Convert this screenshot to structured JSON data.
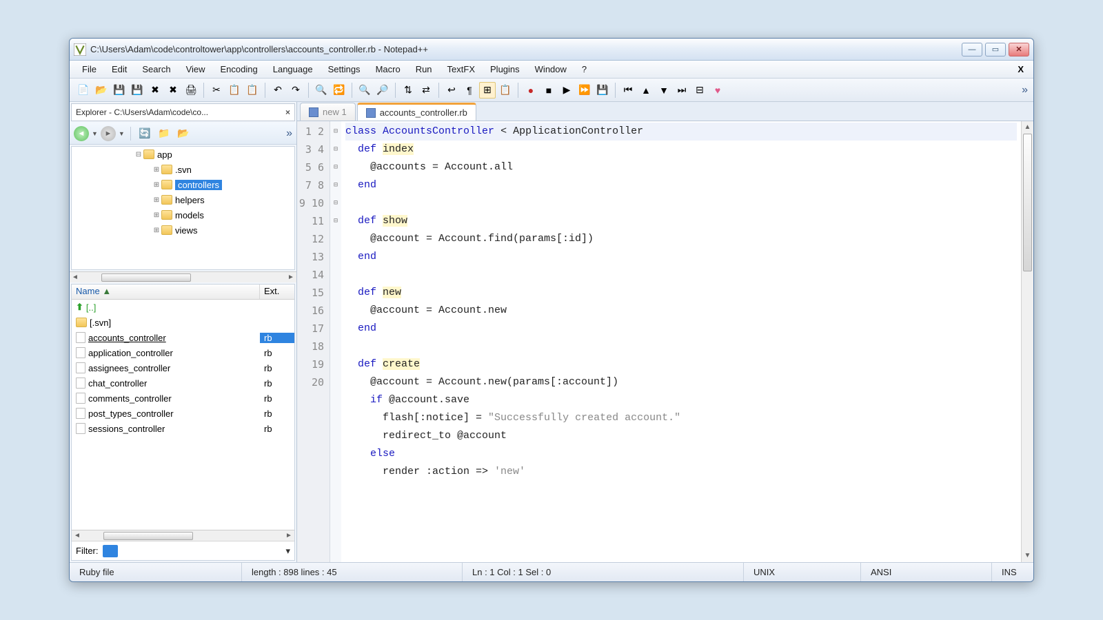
{
  "titlebar": {
    "title": "C:\\Users\\Adam\\code\\controltower\\app\\controllers\\accounts_controller.rb - Notepad++"
  },
  "menu": {
    "items": [
      "File",
      "Edit",
      "Search",
      "View",
      "Encoding",
      "Language",
      "Settings",
      "Macro",
      "Run",
      "TextFX",
      "Plugins",
      "Window",
      "?"
    ],
    "x": "X"
  },
  "toolbar": {
    "icons": [
      "new",
      "open",
      "save",
      "save-all",
      "close",
      "close-all",
      "print",
      "sep",
      "cut",
      "copy",
      "paste",
      "sep",
      "undo",
      "redo",
      "sep",
      "find",
      "replace",
      "sep",
      "zoom-in",
      "zoom-out",
      "sep",
      "sync-v",
      "sync-h",
      "sep",
      "wrap",
      "show-all",
      "indent-guide",
      "udl",
      "sep",
      "record",
      "stop",
      "play",
      "play-multi",
      "save-macro",
      "sep",
      "to-start",
      "up",
      "down",
      "to-end",
      "fold-all",
      "heart"
    ],
    "more": "»"
  },
  "explorer": {
    "title": "Explorer - C:\\Users\\Adam\\code\\co...",
    "tree": [
      {
        "indent": 0,
        "exp": "⊟",
        "label": "app"
      },
      {
        "indent": 1,
        "exp": "⊞",
        "label": ".svn"
      },
      {
        "indent": 1,
        "exp": "⊞",
        "label": "controllers",
        "selected": true
      },
      {
        "indent": 1,
        "exp": "⊞",
        "label": "helpers"
      },
      {
        "indent": 1,
        "exp": "⊞",
        "label": "models"
      },
      {
        "indent": 1,
        "exp": "⊞",
        "label": "views"
      }
    ],
    "filelist": {
      "head_name": "Name",
      "head_ext": "Ext.",
      "rows": [
        {
          "icon": "up",
          "name": "[..]",
          "ext": ""
        },
        {
          "icon": "folder",
          "name": "[.svn]",
          "ext": ""
        },
        {
          "icon": "file",
          "name": "accounts_controller",
          "ext": "rb",
          "selected": true
        },
        {
          "icon": "file",
          "name": "application_controller",
          "ext": "rb"
        },
        {
          "icon": "file",
          "name": "assignees_controller",
          "ext": "rb"
        },
        {
          "icon": "file",
          "name": "chat_controller",
          "ext": "rb"
        },
        {
          "icon": "file",
          "name": "comments_controller",
          "ext": "rb"
        },
        {
          "icon": "file",
          "name": "post_types_controller",
          "ext": "rb"
        },
        {
          "icon": "file",
          "name": "sessions_controller",
          "ext": "rb"
        }
      ]
    },
    "filter_label": "Filter:"
  },
  "tabs": [
    {
      "label": "new 1",
      "active": false
    },
    {
      "label": "accounts_controller.rb",
      "active": true
    }
  ],
  "code": {
    "lines": [
      {
        "n": 1,
        "fold": "⊟",
        "tokens": [
          [
            "kw",
            "class"
          ],
          [
            "txt",
            " "
          ],
          [
            "kw",
            "AccountsController"
          ],
          [
            "txt",
            " < ApplicationController"
          ]
        ],
        "current": true
      },
      {
        "n": 2,
        "fold": "⊟",
        "tokens": [
          [
            "txt",
            "  "
          ],
          [
            "kw",
            "def"
          ],
          [
            "txt",
            " "
          ],
          [
            "hl",
            "index"
          ]
        ]
      },
      {
        "n": 3,
        "fold": "",
        "tokens": [
          [
            "txt",
            "    @accounts = Account.all"
          ]
        ]
      },
      {
        "n": 4,
        "fold": "",
        "tokens": [
          [
            "txt",
            "  "
          ],
          [
            "kw",
            "end"
          ]
        ]
      },
      {
        "n": 5,
        "fold": "",
        "tokens": [
          [
            "txt",
            ""
          ]
        ]
      },
      {
        "n": 6,
        "fold": "⊟",
        "tokens": [
          [
            "txt",
            "  "
          ],
          [
            "kw",
            "def"
          ],
          [
            "txt",
            " "
          ],
          [
            "hl",
            "show"
          ]
        ]
      },
      {
        "n": 7,
        "fold": "",
        "tokens": [
          [
            "txt",
            "    @account = Account.find(params[:id])"
          ]
        ]
      },
      {
        "n": 8,
        "fold": "",
        "tokens": [
          [
            "txt",
            "  "
          ],
          [
            "kw",
            "end"
          ]
        ]
      },
      {
        "n": 9,
        "fold": "",
        "tokens": [
          [
            "txt",
            ""
          ]
        ]
      },
      {
        "n": 10,
        "fold": "⊟",
        "tokens": [
          [
            "txt",
            "  "
          ],
          [
            "kw",
            "def"
          ],
          [
            "txt",
            " "
          ],
          [
            "hl",
            "new"
          ]
        ]
      },
      {
        "n": 11,
        "fold": "",
        "tokens": [
          [
            "txt",
            "    @account = Account.new"
          ]
        ]
      },
      {
        "n": 12,
        "fold": "",
        "tokens": [
          [
            "txt",
            "  "
          ],
          [
            "kw",
            "end"
          ]
        ]
      },
      {
        "n": 13,
        "fold": "",
        "tokens": [
          [
            "txt",
            ""
          ]
        ]
      },
      {
        "n": 14,
        "fold": "⊟",
        "tokens": [
          [
            "txt",
            "  "
          ],
          [
            "kw",
            "def"
          ],
          [
            "txt",
            " "
          ],
          [
            "hl",
            "create"
          ]
        ]
      },
      {
        "n": 15,
        "fold": "",
        "tokens": [
          [
            "txt",
            "    @account = Account.new(params[:account])"
          ]
        ]
      },
      {
        "n": 16,
        "fold": "⊟",
        "tokens": [
          [
            "txt",
            "    "
          ],
          [
            "kw",
            "if"
          ],
          [
            "txt",
            " @account.save"
          ]
        ]
      },
      {
        "n": 17,
        "fold": "",
        "tokens": [
          [
            "txt",
            "      flash[:notice] = "
          ],
          [
            "str",
            "\"Successfully created account.\""
          ]
        ]
      },
      {
        "n": 18,
        "fold": "",
        "tokens": [
          [
            "txt",
            "      redirect_to @account"
          ]
        ]
      },
      {
        "n": 19,
        "fold": "",
        "tokens": [
          [
            "txt",
            "    "
          ],
          [
            "kw",
            "else"
          ]
        ]
      },
      {
        "n": 20,
        "fold": "",
        "tokens": [
          [
            "txt",
            "      render :action => "
          ],
          [
            "str",
            "'new'"
          ]
        ]
      }
    ]
  },
  "status": {
    "filetype": "Ruby file",
    "length": "length : 898    lines : 45",
    "pos": "Ln : 1   Col : 1   Sel : 0",
    "eol": "UNIX",
    "enc": "ANSI",
    "mode": "INS"
  }
}
